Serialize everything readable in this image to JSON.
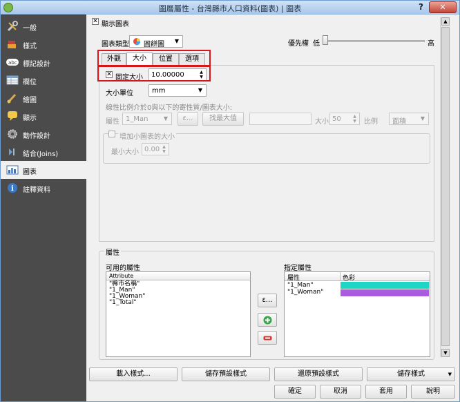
{
  "window": {
    "title": "圖層屬性 - 台灣縣市人口資料(圖表) | 圖表",
    "help": "?",
    "close": "✕"
  },
  "sidebar": {
    "items": [
      {
        "label": "一般",
        "icon": "wrench-icon"
      },
      {
        "label": "樣式",
        "icon": "paintbrush-icon"
      },
      {
        "label": "標記設計",
        "icon": "label-abc-icon"
      },
      {
        "label": "欄位",
        "icon": "table-icon"
      },
      {
        "label": "繪圖",
        "icon": "brush-icon"
      },
      {
        "label": "顯示",
        "icon": "speech-bubble-icon"
      },
      {
        "label": "動作設計",
        "icon": "gear-icon"
      },
      {
        "label": "結合(Joins)",
        "icon": "join-icon"
      },
      {
        "label": "圖表",
        "icon": "chart-icon"
      },
      {
        "label": "註釋資料",
        "icon": "info-icon"
      }
    ],
    "active_index": 8
  },
  "show_diagrams": {
    "label": "顯示圖表",
    "checked": true
  },
  "chart_type": {
    "label": "圖表類型",
    "value": "圓餅圖"
  },
  "priority": {
    "label": "優先權",
    "low": "低",
    "high": "高"
  },
  "tabs": [
    "外觀",
    "大小",
    "位置",
    "選項"
  ],
  "active_tab": 1,
  "size": {
    "fixed_label": "固定大小",
    "fixed_checked": true,
    "fixed_value": "10.00000",
    "unit_label": "大小單位",
    "unit_value": "mm",
    "scale_hint": "線性比例介於0與以下的寄性質/圖表大小:",
    "attr_label": "屬性",
    "attr_value": "1_Man",
    "expr_button": "ε...",
    "find_max": "找最大值",
    "size_label": "大小",
    "size_value": "50",
    "ratio_label": "比例",
    "ratio_value": "面積",
    "increase_label": "增加小圖表的大小",
    "min_size_label": "最小大小",
    "min_size_value": "0.00"
  },
  "attributes": {
    "group_label": "屬性",
    "available_label": "可用的屬性",
    "available_header": "Attribute",
    "available_items": [
      "\"縣市名稱\"",
      "\"1_Man\"",
      "\"1_Woman\"",
      "\"1_Total\""
    ],
    "assigned_label": "指定屬性",
    "assigned_headers": [
      "屬性",
      "色彩"
    ],
    "assigned_items": [
      {
        "name": "\"1_Man\"",
        "color": "#1fd6c6"
      },
      {
        "name": "\"1_Woman\"",
        "color": "#a95ce0"
      }
    ],
    "expr_button": "ε..."
  },
  "footer": {
    "load_style": "載入樣式...",
    "save_default": "儲存預設樣式",
    "restore_default": "還原預設樣式",
    "save_style": "儲存樣式",
    "ok": "確定",
    "cancel": "取消",
    "apply": "套用",
    "help": "說明"
  }
}
